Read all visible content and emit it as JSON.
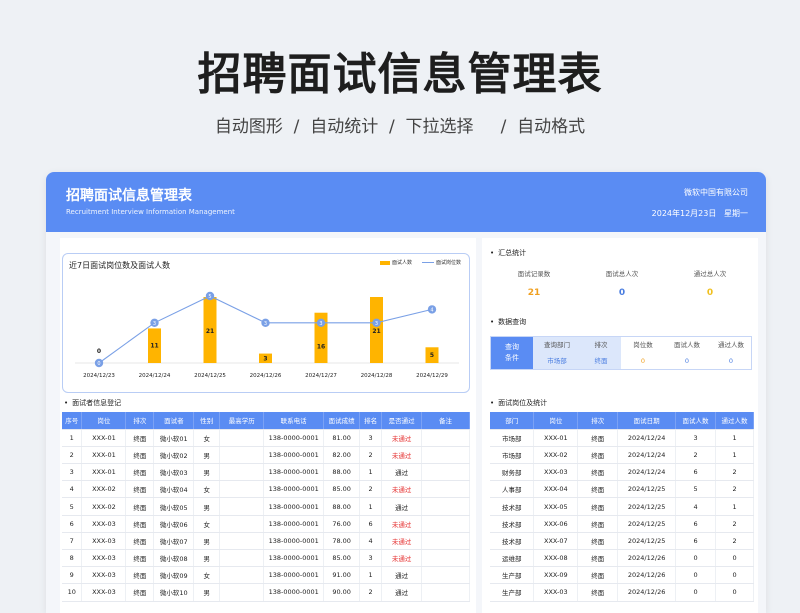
{
  "hero": {
    "title": "招聘面试信息管理表",
    "subtitle": "自动图形  /  自动统计  /  下拉选择     /  自动格式"
  },
  "banner": {
    "title": "招聘面试信息管理表",
    "subtitle": "Recruitment Interview Information Management",
    "company": "微软中国有限公司",
    "date": "2024年12月23日",
    "weekday": "星期一"
  },
  "chart_data": {
    "type": "bar",
    "title": "近7日面试岗位数及面试人数",
    "categories": [
      "2024/12/23",
      "2024/12/24",
      "2024/12/25",
      "2024/12/26",
      "2024/12/27",
      "2024/12/28",
      "2024/12/29"
    ],
    "series": [
      {
        "name": "面试人数",
        "type": "bar",
        "color": "#ffb400",
        "values": [
          0,
          11,
          21,
          3,
          16,
          21,
          5
        ]
      },
      {
        "name": "面试岗位数",
        "type": "line",
        "color": "#7aa0e6",
        "values": [
          0,
          3,
          5,
          3,
          3,
          3,
          4
        ]
      }
    ],
    "legend": "top-right",
    "grid": false
  },
  "left": {
    "section": "面试者信息登记",
    "headers": [
      "序号",
      "岗位",
      "排次",
      "面试者",
      "性别",
      "最高学历",
      "联系电话",
      "面试成绩",
      "排名",
      "是否通过",
      "备注"
    ],
    "rows": [
      [
        "1",
        "XXX-01",
        "终面",
        "微小软01",
        "女",
        "",
        "138-0000-0001",
        "81.00",
        "3",
        "未通过",
        ""
      ],
      [
        "2",
        "XXX-01",
        "终面",
        "微小软02",
        "男",
        "",
        "138-0000-0001",
        "82.00",
        "2",
        "未通过",
        ""
      ],
      [
        "3",
        "XXX-01",
        "终面",
        "微小软03",
        "男",
        "",
        "138-0000-0001",
        "88.00",
        "1",
        "通过",
        ""
      ],
      [
        "4",
        "XXX-02",
        "终面",
        "微小软04",
        "女",
        "",
        "138-0000-0001",
        "85.00",
        "2",
        "未通过",
        ""
      ],
      [
        "5",
        "XXX-02",
        "终面",
        "微小软05",
        "男",
        "",
        "138-0000-0001",
        "88.00",
        "1",
        "通过",
        ""
      ],
      [
        "6",
        "XXX-03",
        "终面",
        "微小软06",
        "女",
        "",
        "138-0000-0001",
        "76.00",
        "6",
        "未通过",
        ""
      ],
      [
        "7",
        "XXX-03",
        "终面",
        "微小软07",
        "男",
        "",
        "138-0000-0001",
        "78.00",
        "4",
        "未通过",
        ""
      ],
      [
        "8",
        "XXX-03",
        "终面",
        "微小软08",
        "男",
        "",
        "138-0000-0001",
        "85.00",
        "3",
        "未通过",
        ""
      ],
      [
        "9",
        "XXX-03",
        "终面",
        "微小软09",
        "女",
        "",
        "138-0000-0001",
        "91.00",
        "1",
        "通过",
        ""
      ],
      [
        "10",
        "XXX-03",
        "终面",
        "微小软10",
        "男",
        "",
        "138-0000-0001",
        "90.00",
        "2",
        "通过",
        ""
      ]
    ]
  },
  "summary": {
    "section": "汇总统计",
    "items": [
      {
        "label": "面试记录数",
        "value": "21",
        "color": "#f0a020"
      },
      {
        "label": "面试总人次",
        "value": "0",
        "color": "#4a7de0"
      },
      {
        "label": "通过总人次",
        "value": "0",
        "color": "#f0c020"
      }
    ]
  },
  "query": {
    "section": "数据查询",
    "button": "查询\n条件",
    "cols": [
      {
        "h": "查询部门",
        "v": "市场部",
        "fill": true,
        "color": "#4a7de0"
      },
      {
        "h": "排次",
        "v": "终面",
        "fill": true,
        "color": "#4a7de0"
      },
      {
        "h": "岗位数",
        "v": "0",
        "fill": false,
        "color": "#f0a020"
      },
      {
        "h": "面试人数",
        "v": "0",
        "fill": false,
        "color": "#4a7de0"
      },
      {
        "h": "通过人数",
        "v": "0",
        "fill": false,
        "color": "#4a7de0"
      }
    ]
  },
  "right": {
    "section": "面试岗位及统计",
    "headers": [
      "部门",
      "岗位",
      "排次",
      "面试日期",
      "面试人数",
      "通过人数"
    ],
    "rows": [
      [
        "市场部",
        "XXX-01",
        "终面",
        "2024/12/24",
        "3",
        "1"
      ],
      [
        "市场部",
        "XXX-02",
        "终面",
        "2024/12/24",
        "2",
        "1"
      ],
      [
        "财务部",
        "XXX-03",
        "终面",
        "2024/12/24",
        "6",
        "2"
      ],
      [
        "人事部",
        "XXX-04",
        "终面",
        "2024/12/25",
        "5",
        "2"
      ],
      [
        "技术部",
        "XXX-05",
        "终面",
        "2024/12/25",
        "4",
        "1"
      ],
      [
        "技术部",
        "XXX-06",
        "终面",
        "2024/12/25",
        "6",
        "2"
      ],
      [
        "技术部",
        "XXX-07",
        "终面",
        "2024/12/25",
        "6",
        "2"
      ],
      [
        "运维部",
        "XXX-08",
        "终面",
        "2024/12/26",
        "0",
        "0"
      ],
      [
        "生产部",
        "XXX-09",
        "终面",
        "2024/12/26",
        "0",
        "0"
      ],
      [
        "生产部",
        "XXX-03",
        "终面",
        "2024/12/26",
        "0",
        "0"
      ]
    ]
  }
}
